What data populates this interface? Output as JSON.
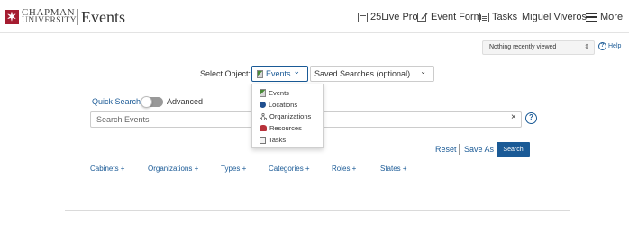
{
  "header": {
    "logo_mark": "✶",
    "logo_line1": "CHAPMAN",
    "logo_line2": "UNIVERSITY",
    "app_title": "Events",
    "nav": {
      "pro": "25Live Pro",
      "event_form": "Event Form",
      "tasks": "Tasks",
      "user": "Miguel Viveros",
      "more": "More"
    }
  },
  "subbar": {
    "recent_select_value": "Nothing recently viewed",
    "recent_select_arrows": "⇕",
    "help_icon": "?",
    "help": "Help"
  },
  "select_object": {
    "label": "Select Object:",
    "selected": "Events",
    "chevron": "⌄",
    "saved_searches": "Saved Searches (optional)",
    "saved_chevron": "⌄",
    "options": [
      "Events",
      "Locations",
      "Organizations",
      "Resources",
      "Tasks"
    ]
  },
  "quick_search": {
    "label": "Quick Search",
    "advanced": "Advanced",
    "placeholder": "Search Events",
    "clear": "×",
    "help": "?"
  },
  "actions": {
    "reset": "Reset",
    "save_as": "Save As",
    "search": "Search"
  },
  "facets": [
    "Cabinets +",
    "Organizations +",
    "Types +",
    "Categories +",
    "Roles +",
    "States +"
  ],
  "colors": {
    "brand_red": "#a51c30",
    "link_blue": "#1a5a96",
    "button_blue": "#1a5a96"
  }
}
